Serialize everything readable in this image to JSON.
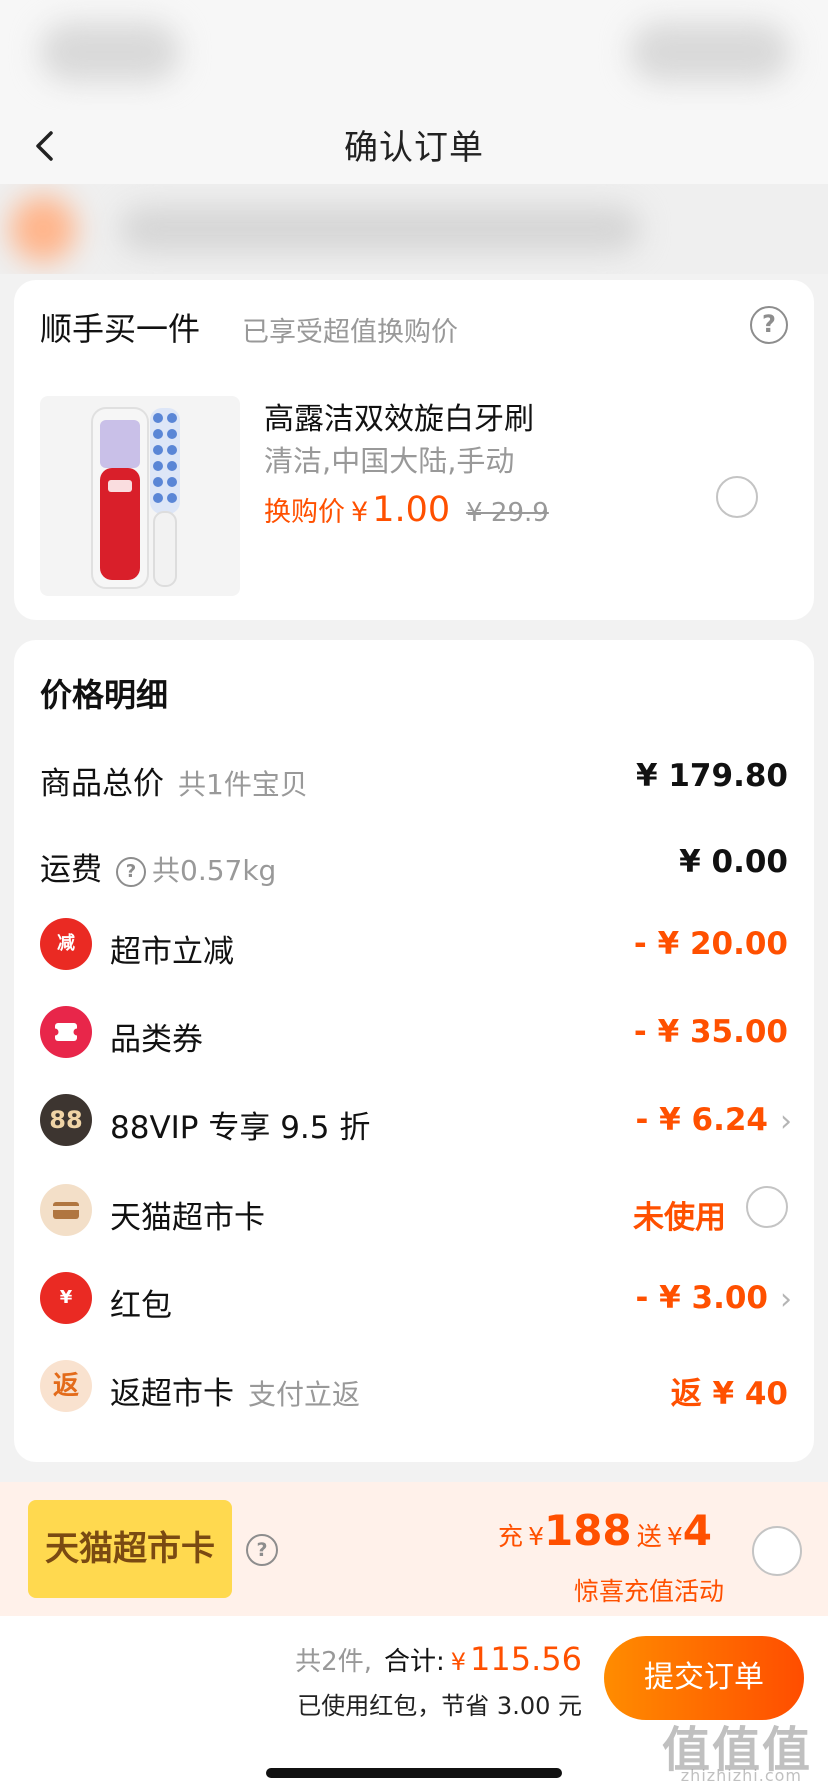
{
  "nav": {
    "title": "确认订单"
  },
  "addon": {
    "title": "顺手买一件",
    "subtitle": "已享受超值换购价",
    "product": {
      "name": "高露洁双效旋白牙刷",
      "spec": "清洁,中国大陆,手动",
      "price_label": "换购价",
      "currency": "¥",
      "price": "1.00",
      "original_price": "¥ 29.9"
    }
  },
  "price_detail": {
    "title": "价格明细",
    "rows": [
      {
        "label": "商品总价",
        "note": "共1件宝贝",
        "value": "¥ 179.80"
      },
      {
        "label": "运费",
        "note": "共0.57kg",
        "value": "¥ 0.00"
      },
      {
        "icon_text": "减",
        "label": "超市立减",
        "value": "- ¥ 20.00"
      },
      {
        "label": "品类券",
        "value": "- ¥ 35.00"
      },
      {
        "icon_text": "88",
        "label": "88VIP 专享 9.5 折",
        "value": "- ¥ 6.24"
      },
      {
        "label": "天猫超市卡",
        "value": "未使用"
      },
      {
        "icon_text": "¥",
        "label": "红包",
        "value": "- ¥ 3.00"
      },
      {
        "icon_text": "返",
        "label": "返超市卡",
        "note": "支付立返",
        "value": "返 ¥ 40"
      }
    ]
  },
  "promo": {
    "card_label": "天猫超市卡",
    "charge_label": "充",
    "charge_currency": "¥",
    "charge_amount": "188",
    "gift_label": "送",
    "gift_currency": "¥",
    "gift_amount": "4",
    "note": "惊喜充值活动"
  },
  "bottom": {
    "count": "共2件,",
    "total_label": "合计:",
    "currency": "¥",
    "total": "115.56",
    "saved": "已使用红包，节省 3.00 元",
    "submit_label": "提交订单"
  },
  "watermark": {
    "main": "值值值",
    "sub": "zhizhizhi.com"
  },
  "colors": {
    "accent": "#ff5000",
    "background": "#f2f2f2",
    "promo_bg": "#fff1ea",
    "card_yellow": "#ffd94f"
  }
}
